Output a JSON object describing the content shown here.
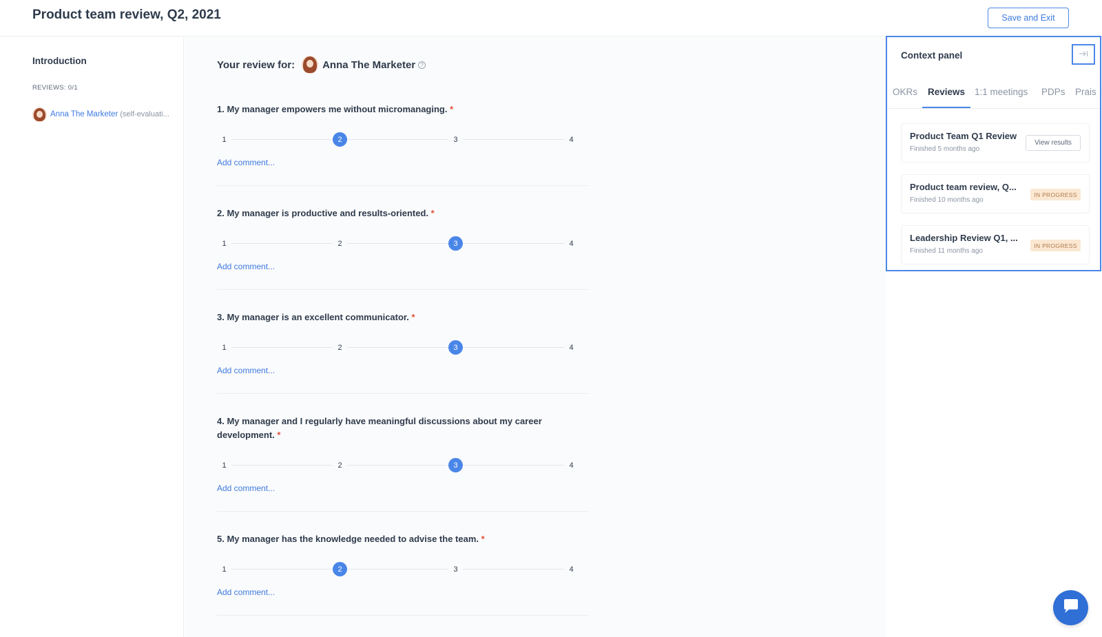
{
  "header": {
    "title": "Product team review, Q2, 2021",
    "save_exit_label": "Save and Exit"
  },
  "sidebar": {
    "section_title": "Introduction",
    "reviews_count": "REVIEWS: 0/1",
    "reviewee": {
      "name": "Anna The Marketer",
      "note": "(self-evaluati..."
    }
  },
  "main": {
    "review_for_label": "Your review for:",
    "reviewee_name": "Anna The Marketer",
    "add_comment_label": "Add comment...",
    "questions": [
      {
        "text": "1. My manager empowers me without micromanaging.",
        "required": "*",
        "scale": [
          "1",
          "2",
          "3",
          "4"
        ],
        "selected": 2
      },
      {
        "text": "2. My manager is productive and results-oriented.",
        "required": "*",
        "scale": [
          "1",
          "2",
          "3",
          "4"
        ],
        "selected": 3
      },
      {
        "text": "3. My manager is an excellent communicator.",
        "required": "*",
        "scale": [
          "1",
          "2",
          "3",
          "4"
        ],
        "selected": 3
      },
      {
        "text": "4. My manager and I regularly have meaningful discussions about my career development.",
        "required": "*",
        "scale": [
          "1",
          "2",
          "3",
          "4"
        ],
        "selected": 3
      },
      {
        "text": "5. My manager has the knowledge needed to advise the team.",
        "required": "*",
        "scale": [
          "1",
          "2",
          "3",
          "4"
        ],
        "selected": 2
      }
    ]
  },
  "context_panel": {
    "title": "Context panel",
    "tabs": [
      "OKRs",
      "Reviews",
      "1:1 meetings",
      "PDPs",
      "Prais"
    ],
    "active_tab": "Reviews",
    "cards": [
      {
        "title": "Product Team Q1 Review",
        "subtitle": "Finished 5 months ago",
        "action": "View results"
      },
      {
        "title": "Product team review, Q...",
        "subtitle": "Finished 10 months ago",
        "status": "IN PROGRESS"
      },
      {
        "title": "Leadership Review Q1, ...",
        "subtitle": "Finished 11 months ago",
        "status": "IN PROGRESS"
      }
    ]
  },
  "colors": {
    "accent": "#4a86e8",
    "required": "#e0533e",
    "badge_bg": "#fbe8d3",
    "chat_button": "#2f6fd6"
  },
  "icons": {
    "info": "info-icon",
    "collapse": "collapse-panel-icon",
    "chat": "chat-icon"
  }
}
